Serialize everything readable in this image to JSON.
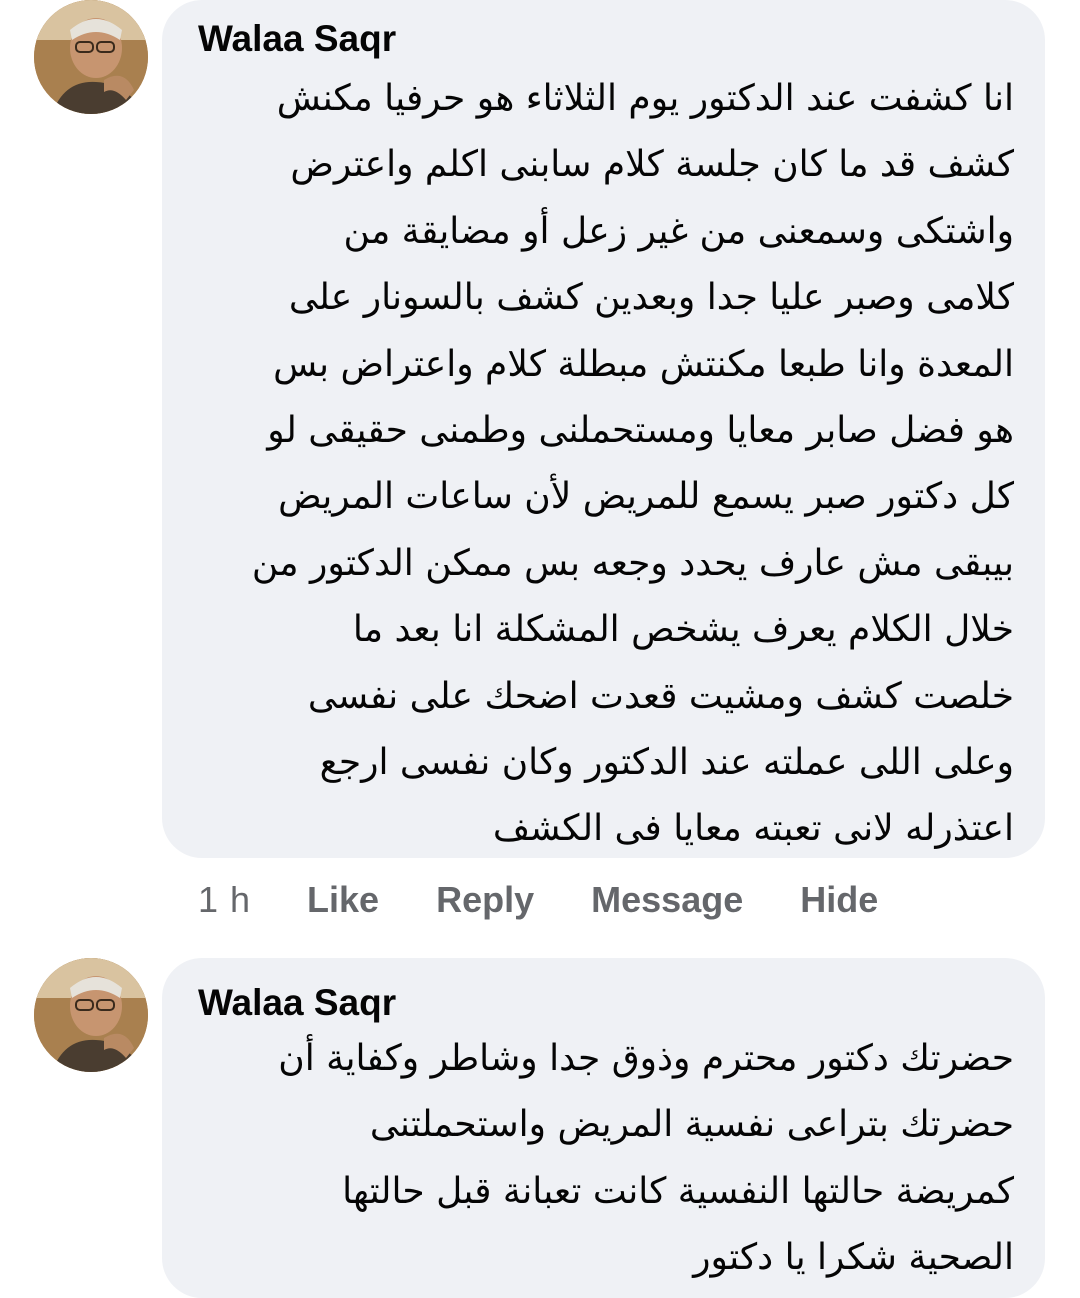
{
  "comments": [
    {
      "author": "Walaa Saqr",
      "avatar_icon": "profile-photo-icon",
      "text": "انا كشفت عند الدكتور يوم الثلاثاء هو حرفيا مكنش\nكشف قد ما كان جلسة كلام سابنى اكلم واعترض\nواشتكى وسمعنى من غير زعل أو مضايقة من\nكلامى وصبر عليا جدا وبعدين كشف بالسونار على\nالمعدة وانا طبعا مكنتش مبطلة كلام واعتراض بس\nهو فضل صابر معايا ومستحملنى وطمنى حقيقى لو\nكل دكتور صبر يسمع للمريض لأن ساعات المريض\nبيبقى مش عارف يحدد وجعه بس ممكن الدكتور من\nخلال الكلام يعرف يشخص المشكلة انا بعد ما\nخلصت كشف ومشيت قعدت اضحك على نفسى\nوعلى اللى عملته عند الدكتور وكان نفسى ارجع\nاعتذرله لانى تعبته معايا فى الكشف",
      "actions": {
        "time": "1 h",
        "like": "Like",
        "reply": "Reply",
        "message": "Message",
        "hide": "Hide"
      }
    },
    {
      "author": "Walaa Saqr",
      "avatar_icon": "profile-photo-icon",
      "text": "حضرتك دكتور محترم وذوق جدا وشاطر وكفاية أن\nحضرتك بتراعى نفسية المريض واستحملتنى\nكمريضة حالتها النفسية كانت تعبانة قبل حالتها\nالصحية شكرا يا دكتور"
    }
  ],
  "colors": {
    "bubble_bg": "#eff1f5",
    "text": "#050505",
    "action_text": "#65676b"
  }
}
